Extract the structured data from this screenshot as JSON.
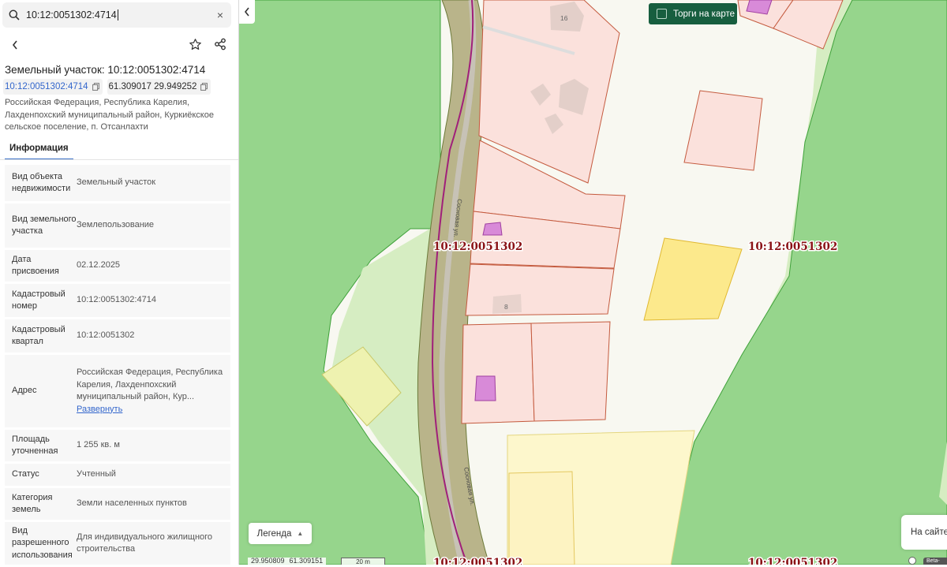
{
  "search": {
    "value": "10:12:0051302:4714",
    "clear_icon": "×"
  },
  "panel": {
    "title": "Земельный участок: 10:12:0051302:4714",
    "cadastral_chip": "10:12:0051302:4714",
    "coords_chip": "61.309017 29.949252",
    "address": "Российская Федерация, Республика Карелия, Лахденпохский муниципальный район, Куркиёкское сельское поселение, п. Отсанлахти",
    "tab": "Информация",
    "rows": [
      {
        "key": "Вид объекта недвижимости",
        "value": "Земельный участок"
      },
      {
        "key": "Вид земельного участка",
        "value": "Землепользование"
      },
      {
        "key": "Дата присвоения",
        "value": "02.12.2025"
      },
      {
        "key": "Кадастровый номер",
        "value": "10:12:0051302:4714"
      },
      {
        "key": "Кадастровый квартал",
        "value": "10:12:0051302"
      },
      {
        "key": "Адрес",
        "value": "Российская Федерация, Республика Карелия, Лахденпохский муниципальный район, Кур...",
        "link": "Развернуть"
      },
      {
        "key": "Площадь уточненная",
        "value": "1 255 кв. м"
      },
      {
        "key": "Статус",
        "value": "Учтенный"
      },
      {
        "key": "Категория земель",
        "value": "Земли населенных пунктов"
      },
      {
        "key": "Вид разрешенного использования",
        "value": "Для индивидуального жилищного строительства"
      }
    ]
  },
  "map": {
    "quarter_label": "10:12:0051302",
    "street_label": "Сосновая ул.",
    "house_numbers": [
      "16",
      "8"
    ],
    "torgi_label": "Торги на карте",
    "legend_label": "Легенда",
    "site_label": "На сайте",
    "coord_lon": "29.950809",
    "coord_lat": "61.309151",
    "scale_label": "20 m",
    "beta_label": "Beta-"
  },
  "colors": {
    "forest": "#96d58c",
    "meadow": "#d6edc2",
    "parcel_fill": "#fbe1dc",
    "parcel_stroke": "#c45a3e",
    "yellow_parcel": "#fce98c",
    "building": "#d88ad8",
    "road": "#b9b48a",
    "accent_green": "#175e3f",
    "link_blue": "#3366cc"
  }
}
